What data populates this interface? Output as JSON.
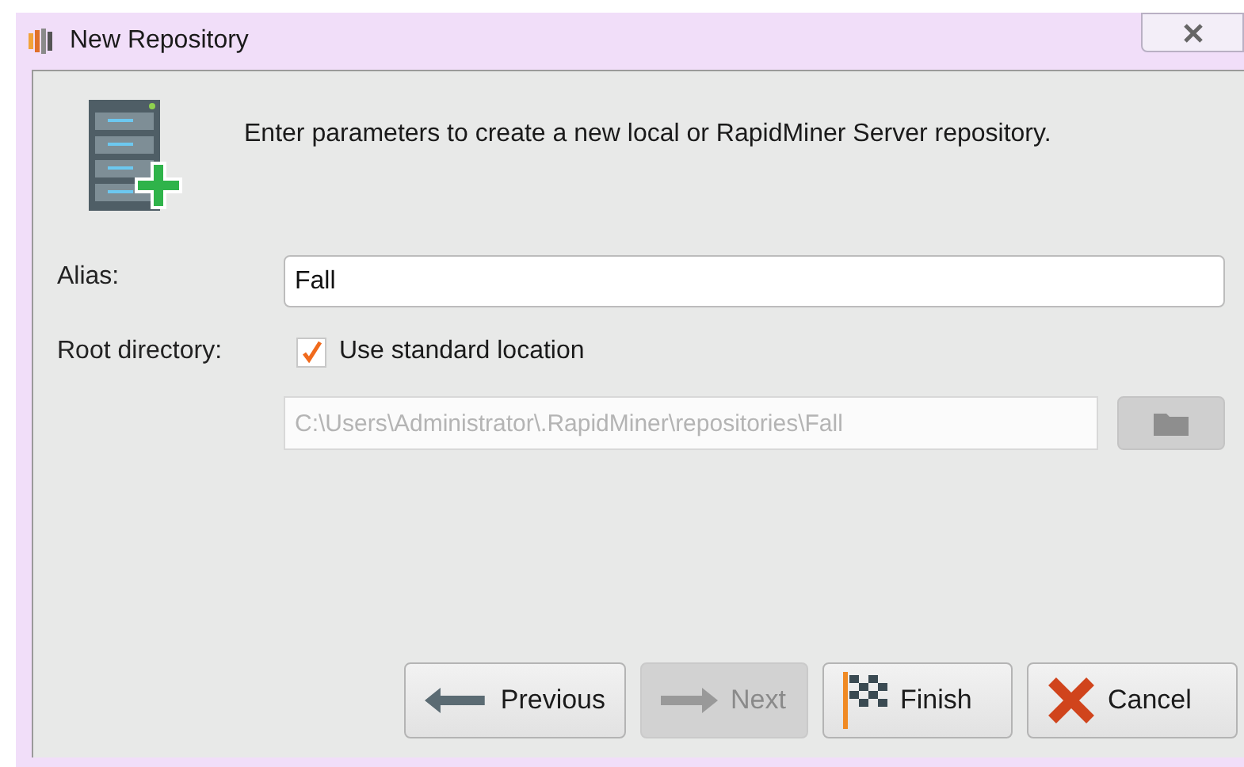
{
  "window": {
    "title": "New Repository"
  },
  "description": "Enter parameters to create a new local or RapidMiner Server repository.",
  "alias": {
    "label": "Alias:",
    "value": "Fall"
  },
  "root_directory": {
    "label": "Root directory:",
    "checkbox": {
      "label": "Use standard location",
      "checked": true
    },
    "path": {
      "value": "C:\\Users\\Administrator\\.RapidMiner\\repositories\\Fall",
      "disabled": true
    },
    "browse_disabled": true
  },
  "buttons": [
    {
      "kind": "previous",
      "label": "Previous",
      "disabled": false
    },
    {
      "kind": "next",
      "label": "Next",
      "disabled": true
    },
    {
      "kind": "finish",
      "label": "Finish",
      "disabled": false
    },
    {
      "kind": "cancel",
      "label": "Cancel",
      "disabled": false
    }
  ]
}
